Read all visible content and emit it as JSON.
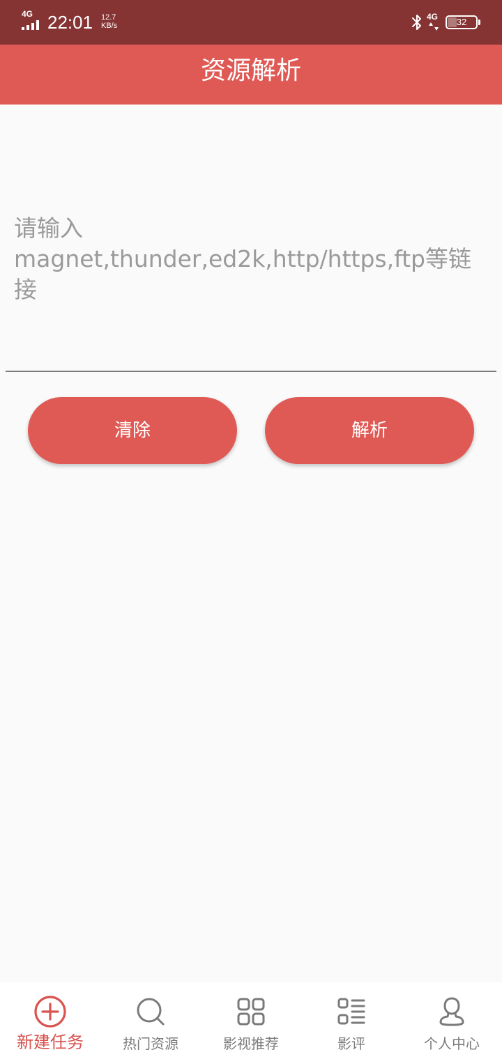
{
  "status_bar": {
    "network_left": "4G",
    "time": "22:01",
    "speed_value": "12.7",
    "speed_unit": "KB/s",
    "network_right": "4G",
    "battery": "32",
    "battery_level": 0.32
  },
  "app_bar": {
    "title": "资源解析"
  },
  "link_input": {
    "value": "",
    "placeholder": "请输入magnet,thunder,ed2k,http/https,ftp等链接"
  },
  "actions": {
    "clear_label": "清除",
    "parse_label": "解析"
  },
  "bottom_nav": {
    "active_color": "#d9534f",
    "inactive_color": "#7a7a7a",
    "items": [
      {
        "label": "新建任务",
        "icon": "plus-circle-icon",
        "active": true
      },
      {
        "label": "热门资源",
        "icon": "search-icon",
        "active": false
      },
      {
        "label": "影视推荐",
        "icon": "grid-icon",
        "active": false
      },
      {
        "label": "影评",
        "icon": "list-icon",
        "active": false
      },
      {
        "label": "个人中心",
        "icon": "user-icon",
        "active": false
      }
    ]
  },
  "theme": {
    "status_bar_color": "#853333",
    "primary_color": "#e05a55"
  }
}
